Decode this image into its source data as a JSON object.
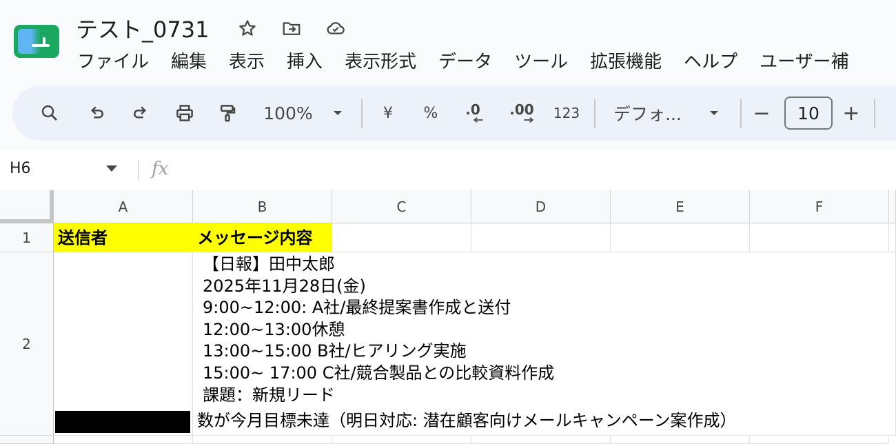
{
  "doc": {
    "title": "テスト_0731"
  },
  "menu": [
    "ファイル",
    "編集",
    "表示",
    "挿入",
    "表示形式",
    "データ",
    "ツール",
    "拡張機能",
    "ヘルプ",
    "ユーザー補"
  ],
  "toolbar": {
    "zoom": "100%",
    "currency": "¥",
    "percent": "%",
    "decrease_decimal": ".0",
    "increase_decimal": ".00",
    "number_format": "123",
    "font": "デフォ...",
    "font_size": "10",
    "minus": "−",
    "plus": "+"
  },
  "formula_bar": {
    "cell_ref": "H6",
    "fx": "fx"
  },
  "grid": {
    "columns": [
      "A",
      "B",
      "C",
      "D",
      "E",
      "F"
    ],
    "rows": [
      "1",
      "2"
    ],
    "header_cells": {
      "a1": "送信者",
      "b1": "メッセージ内容"
    },
    "b2_text": "【日報】田中太郎\n2025年11月28日(金)\n9:00~12:00: A社/最終提案書作成と送付\n12:00~13:00休憩\n13:00~15:00 B社/ヒアリング実施\n15:00~ 17:00 C社/競合製品との比較資料作成\n課題：新規リード",
    "b2_last_line": "数が今月目標未達（明日対応: 潜在顧客向けメールキャンペーン案作成）"
  },
  "colors": {
    "header_fill": "#ffff00",
    "toolbar_bg": "#edf2fa",
    "brand_green": "#1aa861"
  }
}
